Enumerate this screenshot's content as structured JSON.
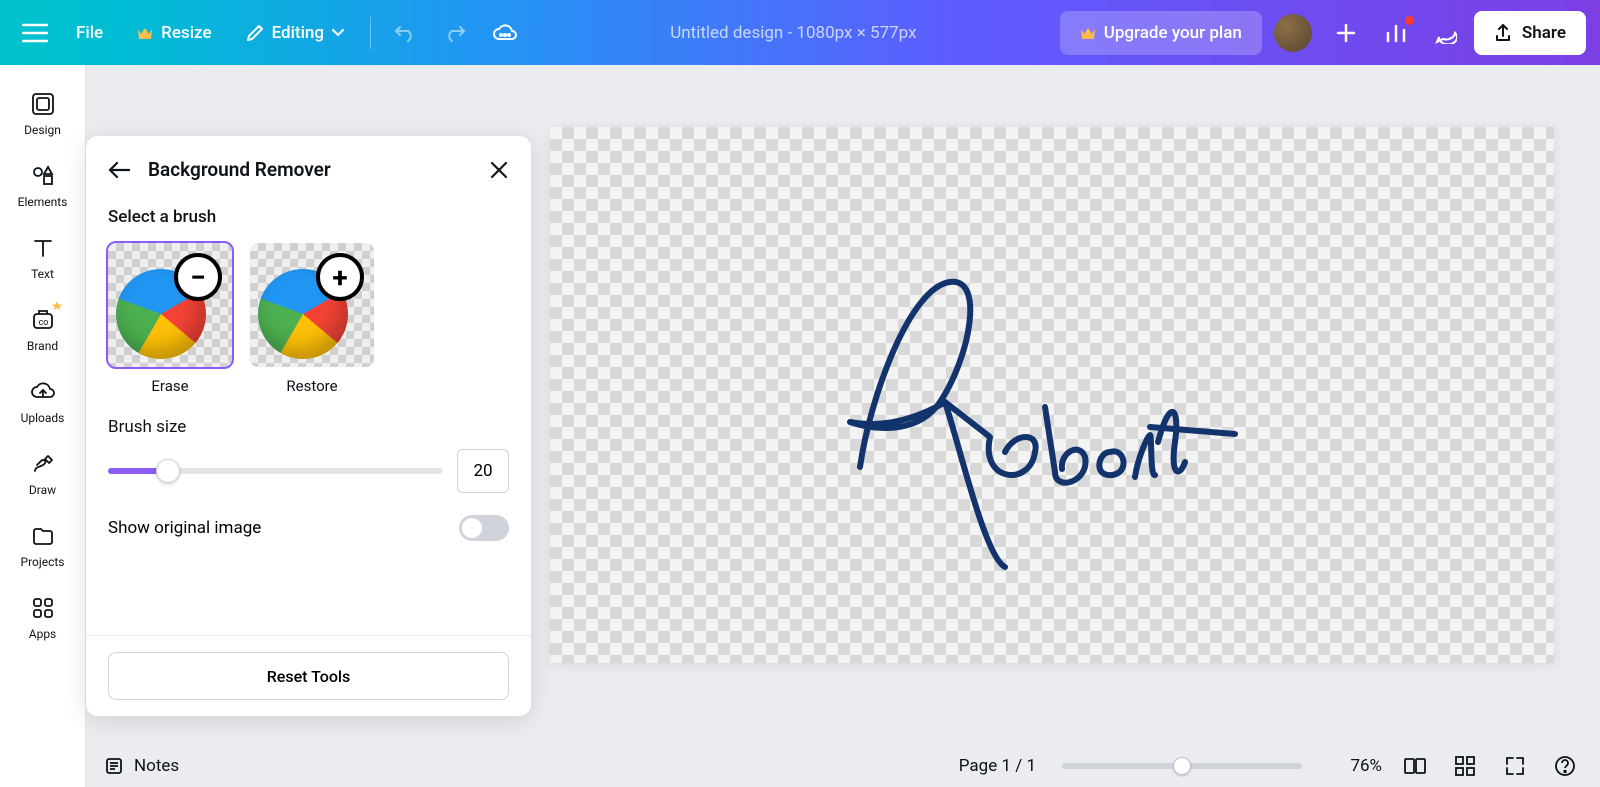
{
  "topbar": {
    "file_label": "File",
    "resize_label": "Resize",
    "editing_label": "Editing",
    "doc_title": "Untitled design - 1080px × 577px",
    "upgrade_label": "Upgrade your plan",
    "share_label": "Share"
  },
  "sidebar": {
    "items": [
      {
        "label": "Design"
      },
      {
        "label": "Elements"
      },
      {
        "label": "Text"
      },
      {
        "label": "Brand"
      },
      {
        "label": "Uploads"
      },
      {
        "label": "Draw"
      },
      {
        "label": "Projects"
      },
      {
        "label": "Apps"
      }
    ]
  },
  "panel": {
    "title": "Background Remover",
    "section_brush": "Select a brush",
    "brush_erase": "Erase",
    "brush_restore": "Restore",
    "brush_size_label": "Brush size",
    "brush_size_value": "20",
    "show_original_label": "Show original image",
    "show_original_on": false,
    "reset_label": "Reset Tools",
    "selected_brush": "erase"
  },
  "canvas": {
    "signature_text": "Robert"
  },
  "bottombar": {
    "notes_label": "Notes",
    "page_indicator": "Page 1 / 1",
    "zoom_pct": "76%"
  }
}
